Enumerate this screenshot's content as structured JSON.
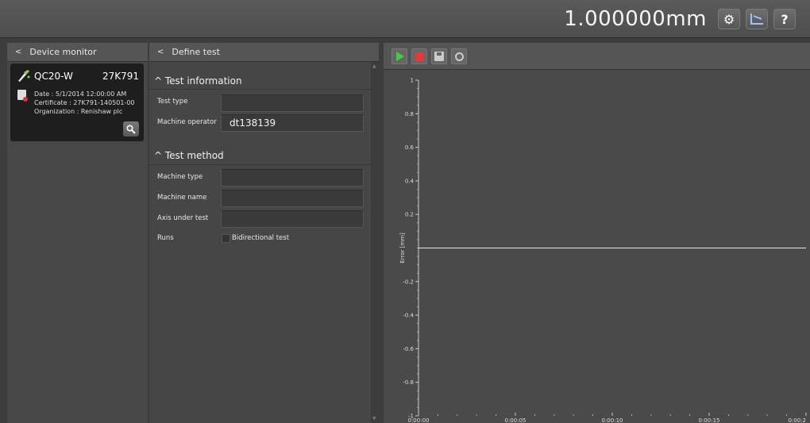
{
  "topbar": {
    "reading": "1.000000mm",
    "settings_icon": "gear-icon",
    "chart_icon": "chart-icon",
    "help_label": "?"
  },
  "device_monitor": {
    "title": "Device monitor",
    "device": {
      "name": "QC20-W",
      "serial": "27K791",
      "date": "Date : 5/1/2014 12:00:00 AM",
      "certificate": "Certificate : 27K791-140501-00",
      "organization": "Organization : Renishaw plc"
    }
  },
  "define_test": {
    "title": "Define test",
    "sections": {
      "test_information": "^ Test information",
      "test_method": "^ Test method"
    },
    "fields": {
      "test_type": {
        "label": "Test type",
        "value": ""
      },
      "machine_operator": {
        "label": "Machine operator",
        "value": "dt138139"
      },
      "machine_type": {
        "label": "Machine type",
        "value": ""
      },
      "machine_name": {
        "label": "Machine name",
        "value": ""
      },
      "axis_under_test": {
        "label": "Axis under test",
        "value": ""
      },
      "runs": {
        "label": "Runs",
        "checkbox_label": "Bidirectional test",
        "checked": false
      }
    }
  },
  "colors": {
    "play": "#3fcf3f",
    "stop": "#e03a3a",
    "panel_bg": "#4a4a4a",
    "card_bg": "#1e1e1e"
  },
  "chart_data": {
    "type": "line",
    "ylabel": "Error [mm]",
    "xlabel": "",
    "title": "",
    "ylim": [
      -1,
      1
    ],
    "yticks": [
      1,
      0.8,
      0.6,
      0.4,
      0.2,
      -0.2,
      -0.4,
      -0.6,
      -0.8,
      -1
    ],
    "ytick_labels": [
      "1",
      "0.8",
      "0.6",
      "0.4",
      "0.2",
      "-0.2",
      "-0.4",
      "-0.6",
      "-0.8",
      "-1"
    ],
    "xticks": [
      "0:00:00",
      "0:00:05",
      "0:00:10",
      "0:00:15",
      "0:00:2"
    ],
    "xlim_seconds": [
      0,
      20
    ],
    "series": [
      {
        "x": [
          0,
          20
        ],
        "y": [
          0,
          0
        ],
        "color": "#e6e6e6"
      }
    ]
  }
}
